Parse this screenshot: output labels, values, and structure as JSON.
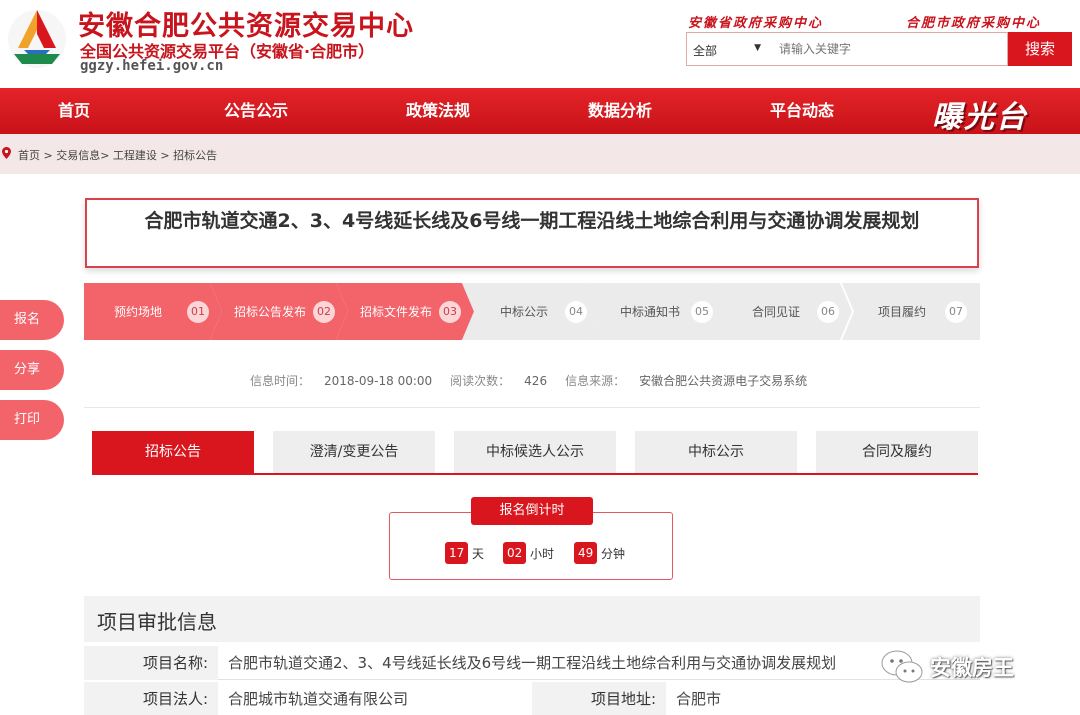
{
  "header": {
    "site_title": "安徽合肥公共资源交易中心",
    "site_subtitle": "全国公共资源交易平台（安徽省·合肥市）",
    "site_domain": "ggzy.hefei.gov.cn",
    "top_link_province": "安徽省政府采购中心",
    "top_link_city": "合肥市政府采购中心",
    "search": {
      "scope_selected": "全部",
      "placeholder": "请输入关键字",
      "button_label": "搜索"
    }
  },
  "nav": {
    "items": [
      "首页",
      "公告公示",
      "政策法规",
      "数据分析",
      "平台动态"
    ],
    "brand": "曝光台"
  },
  "breadcrumb": {
    "text": "首页 > 交易信息> 工程建设 > 招标公告"
  },
  "side_actions": [
    "报名",
    "分享",
    "打印"
  ],
  "notice": {
    "title": "合肥市轨道交通2、3、4号线延长线及6号线一期工程沿线土地综合利用与交通协调发展规划"
  },
  "steps": [
    {
      "label": "预约场地",
      "num": "01",
      "done": true
    },
    {
      "label": "招标公告发布",
      "num": "02",
      "done": true
    },
    {
      "label": "招标文件发布",
      "num": "03",
      "done": true
    },
    {
      "label": "中标公示",
      "num": "04",
      "done": false
    },
    {
      "label": "中标通知书",
      "num": "05",
      "done": false
    },
    {
      "label": "合同见证",
      "num": "06",
      "done": false
    },
    {
      "label": "项目履约",
      "num": "07",
      "done": false
    }
  ],
  "info": {
    "time_label": "信息时间：",
    "time_value": "2018-09-18 00:00",
    "views_label": "阅读次数：",
    "views_value": "426",
    "source_label": "信息来源：",
    "source_value": "安徽合肥公共资源电子交易系统"
  },
  "tabs": [
    {
      "label": "招标公告",
      "active": true
    },
    {
      "label": "澄清/变更公告",
      "active": false
    },
    {
      "label": "中标候选人公示",
      "active": false
    },
    {
      "label": "中标公示",
      "active": false
    },
    {
      "label": "合同及履约",
      "active": false
    }
  ],
  "countdown": {
    "title": "报名倒计时",
    "days": "17",
    "days_unit": "天",
    "hours": "02",
    "hours_unit": "小时",
    "minutes": "49",
    "minutes_unit": "分钟"
  },
  "approval": {
    "section_title": "项目审批信息",
    "project_name_label": "项目名称:",
    "project_name_value": "合肥市轨道交通2、3、4号线延长线及6号线一期工程沿线土地综合利用与交通协调发展规划",
    "legal_person_label": "项目法人:",
    "legal_person_value": "合肥城市轨道交通有限公司",
    "address_label": "项目地址:",
    "address_value": "合肥市"
  },
  "watermark": {
    "text": "安徽房王"
  },
  "colors": {
    "brand_red": "#d9161e",
    "step_done": "#f2636a",
    "step_todo": "#ebebeb"
  }
}
